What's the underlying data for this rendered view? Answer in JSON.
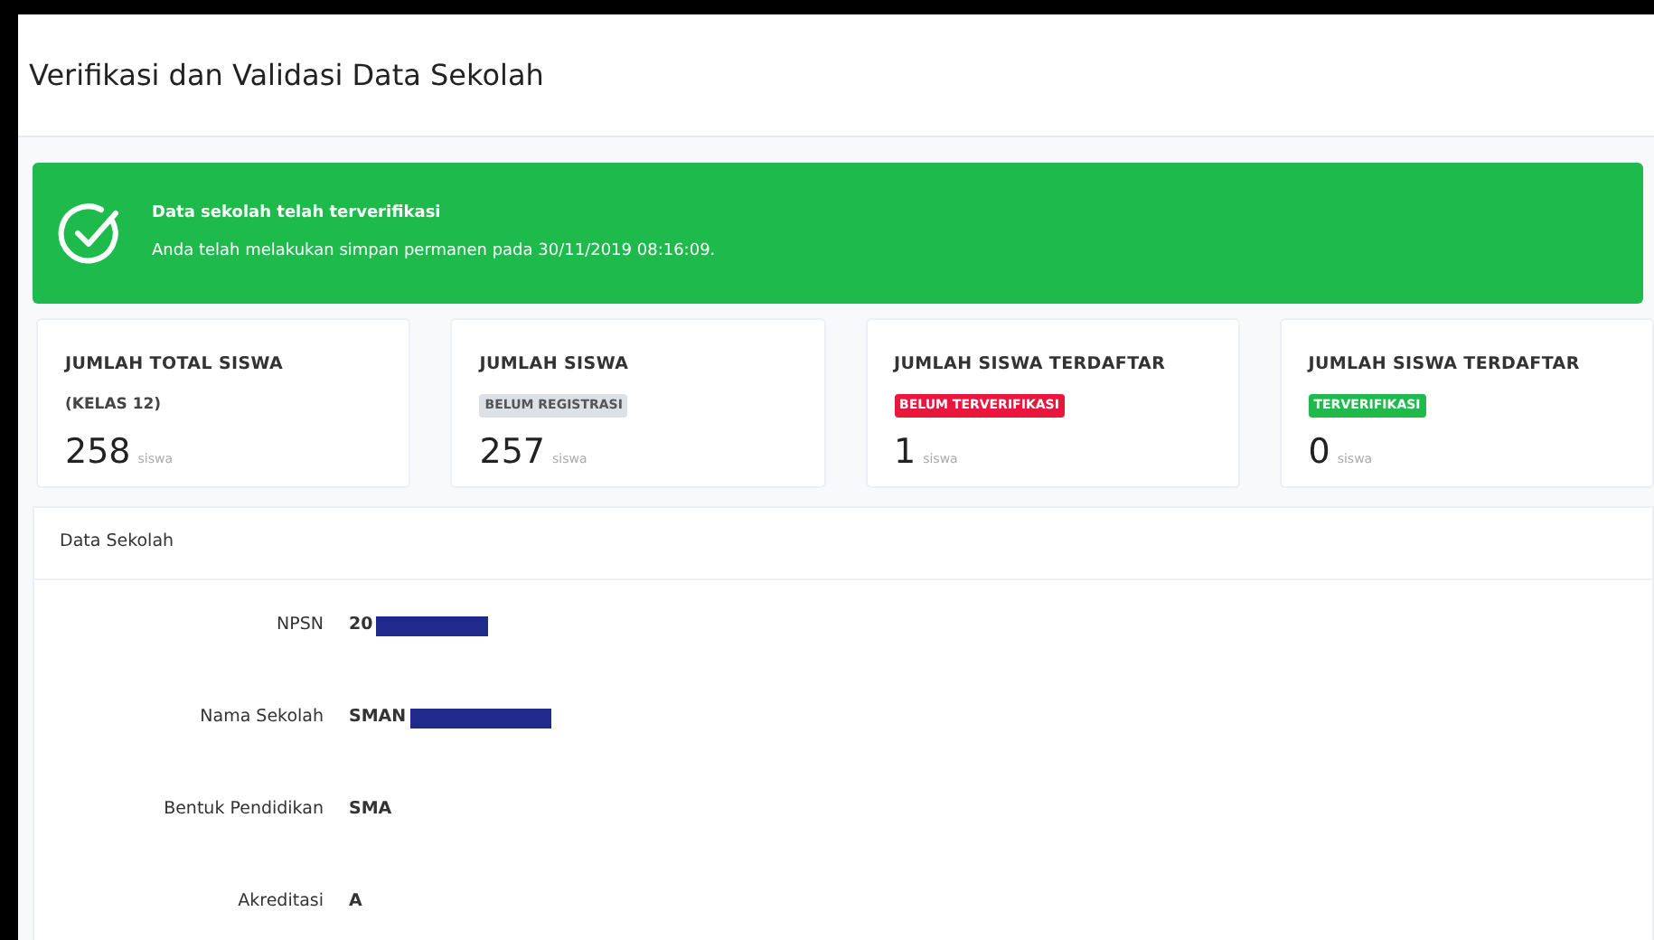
{
  "page": {
    "title": "Verifikasi dan Validasi Data Sekolah"
  },
  "alert": {
    "title": "Data sekolah telah terverifikasi",
    "message": "Anda telah melakukan simpan permanen pada 30/11/2019 08:16:09."
  },
  "stats": [
    {
      "label": "JUMLAH TOTAL SISWA",
      "note": {
        "text": "(KELAS 12)",
        "kind": "plain"
      },
      "value": "258",
      "unit": "siswa"
    },
    {
      "label": "JUMLAH SISWA",
      "note": {
        "text": "BELUM REGISTRASI",
        "kind": "grey"
      },
      "value": "257",
      "unit": "siswa"
    },
    {
      "label": "JUMLAH SISWA TERDAFTAR",
      "note": {
        "text": "BELUM TERVERIFIKASI",
        "kind": "red"
      },
      "value": "1",
      "unit": "siswa"
    },
    {
      "label": "JUMLAH SISWA TERDAFTAR",
      "note": {
        "text": "TERVERIFIKASI",
        "kind": "green"
      },
      "value": "0",
      "unit": "siswa"
    }
  ],
  "data_card": {
    "title": "Data Sekolah",
    "fields": [
      {
        "label": "NPSN",
        "value": "20",
        "redacted": true
      },
      {
        "label": "Nama Sekolah",
        "value": "SMAN",
        "redacted": true
      },
      {
        "label": "Bentuk Pendidikan",
        "value": "SMA",
        "redacted": false
      },
      {
        "label": "Akreditasi",
        "value": "A",
        "redacted": false
      }
    ]
  }
}
